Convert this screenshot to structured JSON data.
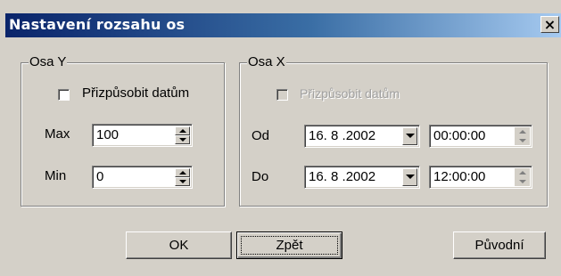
{
  "window": {
    "title": "Nastavení rozsahu os",
    "close_label": "×"
  },
  "axis_y": {
    "legend": "Osa Y",
    "fit_label": "Přizpůsobit datům",
    "fit_checked": false,
    "max_label": "Max",
    "max_value": "100",
    "min_label": "Min",
    "min_value": "0"
  },
  "axis_x": {
    "legend": "Osa X",
    "fit_label": "Přizpůsobit datům",
    "fit_checked": false,
    "fit_enabled": false,
    "from_label": "Od",
    "from_date": "16. 8 .2002",
    "from_time": "00:00:00",
    "to_label": "Do",
    "to_date": "16. 8 .2002",
    "to_time": "12:00:00"
  },
  "buttons": {
    "ok": "OK",
    "back": "Zpět",
    "original": "Původní"
  }
}
